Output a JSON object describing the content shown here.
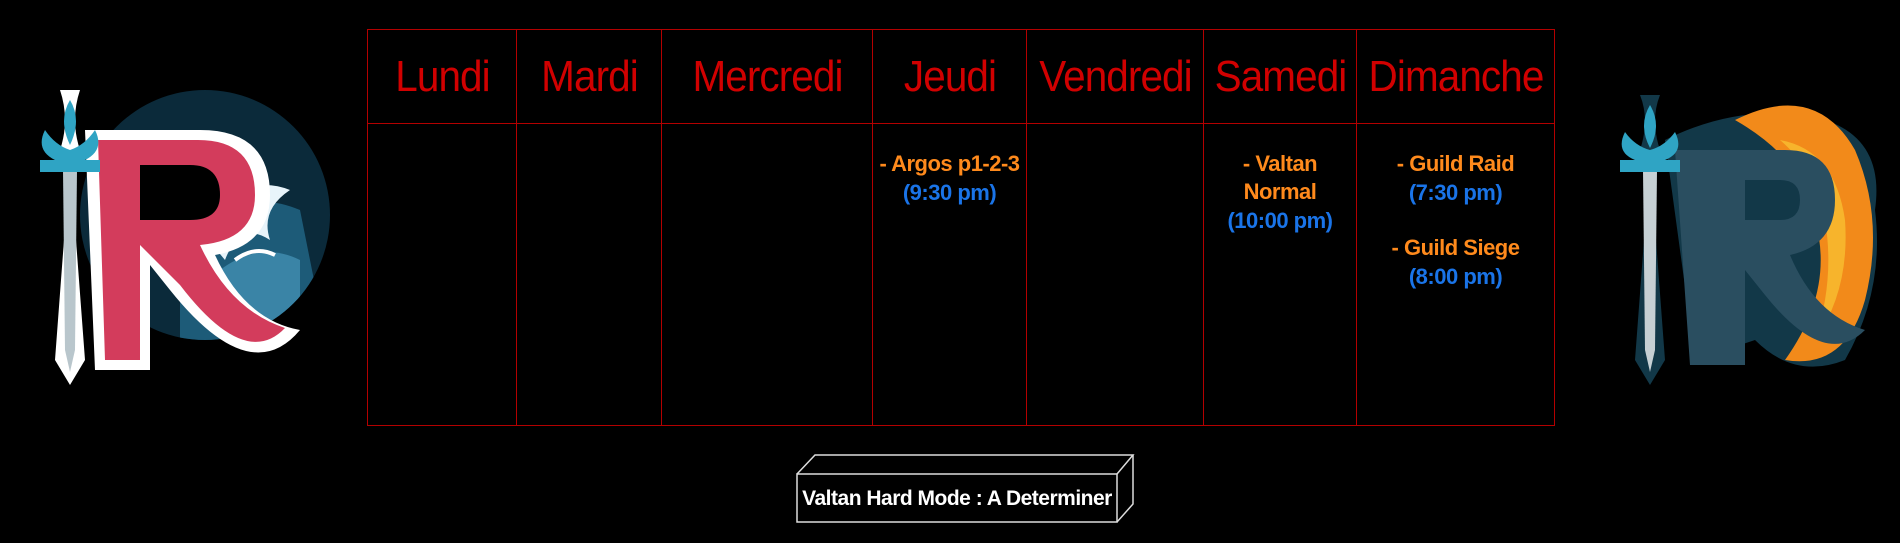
{
  "schedule": {
    "days": [
      "Lundi",
      "Mardi",
      "Mercredi",
      "Jeudi",
      "Vendredi",
      "Samedi",
      "Dimanche"
    ],
    "events": {
      "jeudi": [
        {
          "name": "- Argos p1-2-3",
          "time": "(9:30 pm)"
        }
      ],
      "samedi": [
        {
          "name": "- Valtan Normal",
          "time": "(10:00 pm)"
        }
      ],
      "dimanche": [
        {
          "name": "- Guild Raid",
          "time": "(7:30 pm)"
        },
        {
          "name": "- Guild Siege",
          "time": "(8:00 pm)"
        }
      ]
    }
  },
  "note": {
    "label": "Valtan Hard Mode : A Determiner"
  },
  "colors": {
    "day_header": "#d10000",
    "border": "#b30000",
    "event_name": "#ff8a1c",
    "event_time": "#1a74e8",
    "logo_left_accent": "#d33c5c",
    "logo_right_accent": "#f28a1a",
    "fleur_de_lis": "#2fa4c4"
  },
  "icons": {
    "left_logo": "guild-emblem-red-r-wave-icon",
    "right_logo": "guild-emblem-orange-r-icon"
  }
}
